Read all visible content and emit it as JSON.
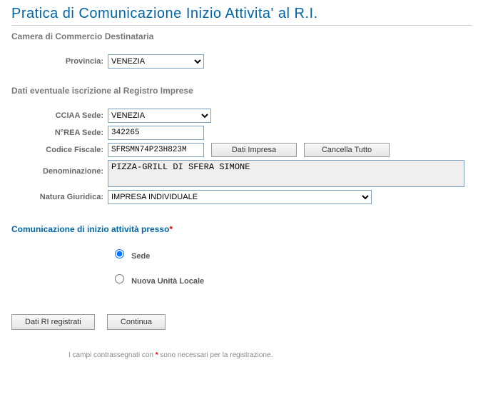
{
  "title": "Pratica di Comunicazione Inizio Attivita' al R.I.",
  "sections": {
    "camera": "Camera di Commercio Destinataria",
    "dati_iscrizione": "Dati eventuale iscrizione al Registro Imprese",
    "comunicazione": "Comunicazione di inizio attività presso"
  },
  "labels": {
    "provincia": "Provincia:",
    "cciaa_sede": "CCIAA Sede:",
    "nrea_sede": "N°REA Sede:",
    "codice_fiscale": "Codice Fiscale:",
    "denominazione": "Denominazione:",
    "natura_giuridica": "Natura Giuridica:"
  },
  "values": {
    "provincia": "VENEZIA",
    "cciaa_sede": "VENEZIA",
    "nrea_sede": "342265",
    "codice_fiscale": "SFRSMN74P23H823M",
    "denominazione": "PIZZA-GRILL DI SFERA SIMONE",
    "natura_giuridica": "IMPRESA INDIVIDUALE"
  },
  "buttons": {
    "dati_impresa": "Dati Impresa",
    "cancella_tutto": "Cancella Tutto",
    "dati_ri": "Dati RI registrati",
    "continua": "Continua"
  },
  "radios": {
    "sede": "Sede",
    "nuova_unita": "Nuova Unità Locale"
  },
  "footnote": {
    "pre": "I campi contrassegnati con ",
    "star": "*",
    "post": " sono necessari per la registrazione."
  }
}
